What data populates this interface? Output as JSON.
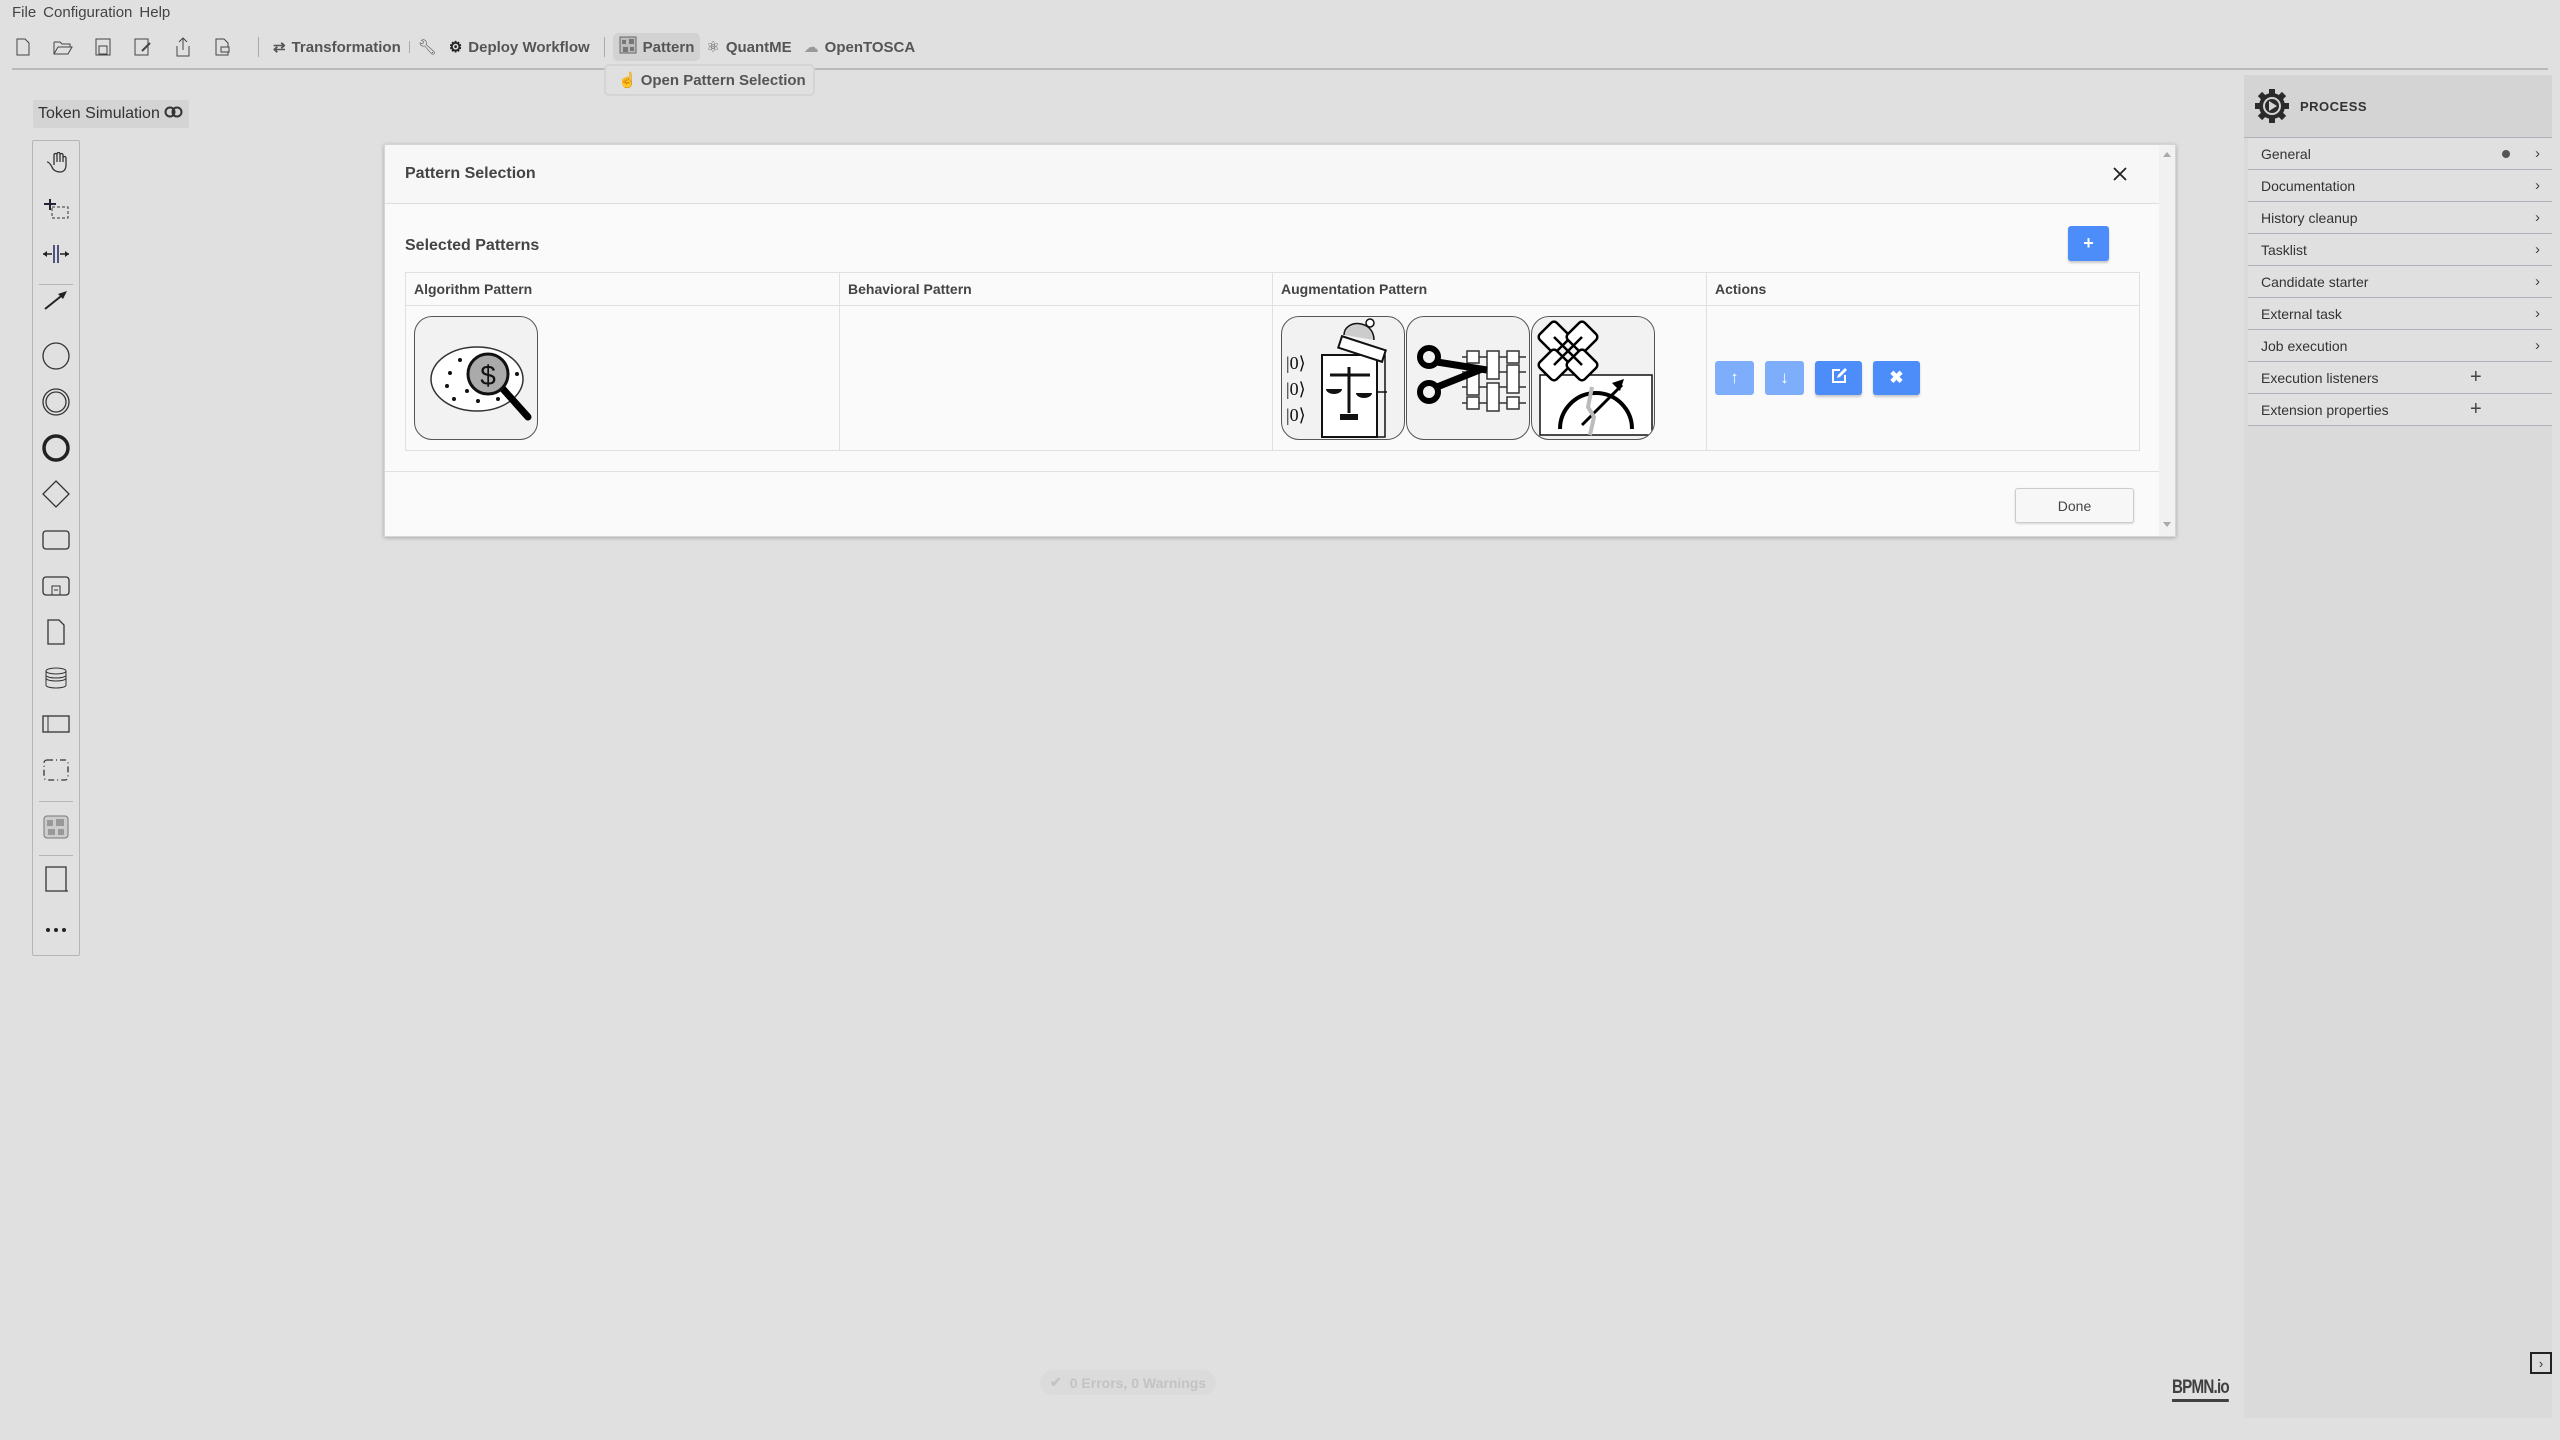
{
  "menubar": {
    "items": [
      "File",
      "Configuration",
      "Help"
    ]
  },
  "toolbar": {
    "file_icons": [
      "new-file-icon",
      "open-folder-icon",
      "save-icon",
      "save-as-icon",
      "upload-icon",
      "export-file-icon"
    ],
    "transformation_label": "Transformation",
    "deploy_label": "Deploy Workflow",
    "pattern_label": "Pattern",
    "quantme_label": "QuantME",
    "opentosca_label": "OpenTOSCA",
    "pattern_dropdown_item": "Open Pattern Selection"
  },
  "token_simulation": {
    "label": "Token Simulation"
  },
  "palette": {
    "tools": [
      "hand-tool",
      "lasso-tool",
      "space-tool",
      "global-connect-tool",
      "start-event",
      "intermediate-event",
      "end-event",
      "gateway",
      "task",
      "subprocess",
      "data-object",
      "data-store",
      "pool",
      "group",
      "pattern-tool",
      "text-annotation",
      "more-tools"
    ]
  },
  "dialog": {
    "title": "Pattern Selection",
    "section_title": "Selected Patterns",
    "add_label": "+",
    "columns": [
      "Algorithm Pattern",
      "Behavioral Pattern",
      "Augmentation Pattern",
      "Actions"
    ],
    "rows": [
      {
        "algorithm": [
          "amplitude-estimation-pattern"
        ],
        "behavioral": [],
        "augmentation": [
          "readout-error-mitigation-pattern",
          "circuit-cutting-pattern",
          "error-correction-pattern"
        ],
        "actions": [
          {
            "icon": "arrow-up-icon",
            "glyph": "↑",
            "enabled": false
          },
          {
            "icon": "arrow-down-icon",
            "glyph": "↓",
            "enabled": false
          },
          {
            "icon": "edit-icon",
            "glyph": "✎",
            "enabled": true
          },
          {
            "icon": "delete-icon",
            "glyph": "✖",
            "enabled": true
          }
        ]
      }
    ],
    "done_label": "Done"
  },
  "properties": {
    "header": "PROCESS",
    "groups": [
      {
        "label": "General",
        "type": "chevron",
        "has_dot": true
      },
      {
        "label": "Documentation",
        "type": "chevron"
      },
      {
        "label": "History cleanup",
        "type": "chevron"
      },
      {
        "label": "Tasklist",
        "type": "chevron"
      },
      {
        "label": "Candidate starter",
        "type": "chevron"
      },
      {
        "label": "External task",
        "type": "chevron"
      },
      {
        "label": "Job execution",
        "type": "chevron"
      },
      {
        "label": "Execution listeners",
        "type": "plus"
      },
      {
        "label": "Extension properties",
        "type": "plus"
      }
    ]
  },
  "status": {
    "text": "0 Errors, 0 Warnings"
  },
  "logo": {
    "text": "BPMN.io"
  },
  "colors": {
    "primary": "#4d8df9",
    "primary_disabled": "#7eaefb",
    "background": "#e0e0e0"
  }
}
